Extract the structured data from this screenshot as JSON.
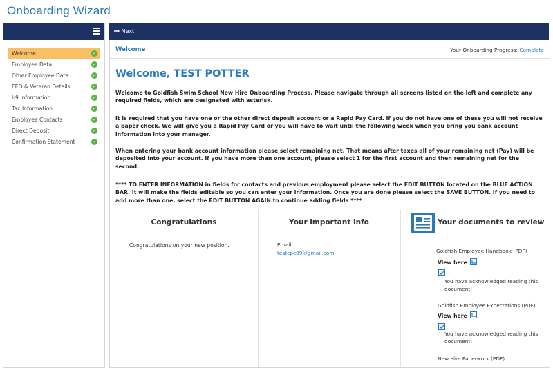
{
  "app": {
    "title": "Onboarding Wizard"
  },
  "sidebar": {
    "items": [
      {
        "label": "Welcome",
        "active": true
      },
      {
        "label": "Employee Data"
      },
      {
        "label": "Other Employee Data"
      },
      {
        "label": "EEO & Veteran Details"
      },
      {
        "label": "I-9 Information"
      },
      {
        "label": "Tax Information"
      },
      {
        "label": "Employee Contacts"
      },
      {
        "label": "Direct Deposit"
      },
      {
        "label": "Confirmation Statement"
      }
    ]
  },
  "toolbar": {
    "next_label": "Next"
  },
  "page": {
    "breadcrumb": "Welcome",
    "progress_label": "Your Onboarding Progress:",
    "progress_value": "Complete",
    "heading": "Welcome, TEST POTTER",
    "paragraphs": [
      "Welcome to Goldfish Swim School New Hire Onboarding Process. Please navigate through all screens listed on the left and complete any required fields, which are designated with asterisk.",
      "It is required that you have one or the other direct deposit account or a Rapid Pay Card. If you do not have one of these you will not receive a paper check. We will give you a Rapid Pay Card or you will have to wait until the following week when you bring you bank account information into your manager.",
      "When entering your bank account information please select remaining net. That means after taxes all of your remaining net (Pay) will be deposited into your account. If you have more than one account, please select 1 for the first account and then remaining net for the second.",
      "**** TO ENTER INFORMATION in fields for contacts and previous employment please select the EDIT BUTTON located on the BLUE ACTION BAR. It will make the fields editable so you can enter your information. Once you are done please select the SAVE BUTTON. If you need to add more than one, select the EDIT BUTTON AGAIN to continue adding fields ****"
    ]
  },
  "congrats": {
    "title": "Congratulations",
    "text": "Congratulations on your new position."
  },
  "info": {
    "title": "Your important info",
    "email_label": "Email",
    "email_value": "testcpc09@gmail.com"
  },
  "documents": {
    "title": "Your documents to review",
    "view_label": "View here",
    "ack_text": "You have acknowledged reading this document!",
    "items": [
      {
        "name": "Goldfish Employee Handbook (PDF)"
      },
      {
        "name": "Goldfish Employee Expectations (PDF)"
      },
      {
        "name": "New Hire Paperwork (PDF)"
      }
    ]
  },
  "colors": {
    "brand_blue": "#2a7ab9",
    "nav_bar": "#1e3163",
    "active_item": "#f9bf63",
    "check_green": "#58b244"
  }
}
